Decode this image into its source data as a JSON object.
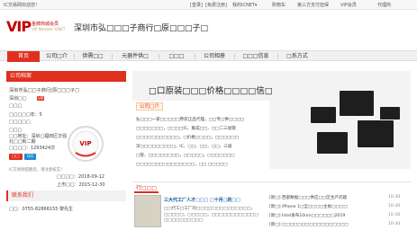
{
  "topbar": {
    "brand": "IC交易网欢迎您！",
    "login": "[登录]",
    "free_reg": "[免费注册]",
    "my": "我的ICNET▾",
    "cart": "购物车",
    "third_party": "第三方支付担保",
    "vip": "VIP会员",
    "proxy": "代理商"
  },
  "logo": {
    "main": "VIP",
    "sub": "金牌商城会员",
    "sub2": "VIP Member ICNET"
  },
  "company_title": "深圳市弘□□□子商行□原□□□子□",
  "nav": {
    "items": [
      "首页",
      "公司□介",
      "供需□□",
      "元器件供□",
      "□□□",
      "公司相册",
      "□□□信息",
      "□系方式"
    ]
  },
  "sidebar": {
    "header": "公司档案",
    "company_name": "深圳市弘□□子商行[原□□□子□",
    "lines": [
      "深圳□□",
      "□□□",
      "□□□□□年：5",
      "□□□□□",
      "□□□"
    ],
    "badge": "VIP",
    "addr": "□□地址：深圳□福田区华强北□□街二期",
    "hits": "□□□□：1293424次",
    "btn_msg": "□□",
    "btn_qq": "QQ",
    "mall_label": "IC交易网提醒您，请注意核实！",
    "reg_date_label": "□□□□：2018-09-12",
    "reg_date2_label": "上市□□：2015-12-30",
    "contact_header": "联系我们",
    "phone": "□□：0755-82866155 黎先生"
  },
  "banner": {
    "text": "□口原装□□□价格□□□□信□"
  },
  "about": {
    "tab": "公司□介",
    "lines": [
      "弘□□□一家□□□□□原装正品代理，□□专□供□□□□",
      "□□□□□□□，□□□□IC、集成□□、□□二三极管",
      "□□□□□□□□□□□，□价格□□□□，□□□□□□",
      "深□□□□□□□□□，IC、□□、□□、□□、三极",
      "□管、□□□□□□□□，□□□□□，□□□□□□□",
      "□□□□□□□□□□□□□□□，□□ □□□□□"
    ]
  },
  "news": {
    "tab": "行□□□",
    "headline": "三大代工厂人才□□□  □十月□的□□",
    "paras": [
      "□□代工□工厂的□□□□□□□□□□□□□□，",
      "□□□□□，□□□□□，□□□□□□□□□□□□",
      "□□□□□□□□□□"
    ],
    "items": [
      "[新□] 西部数据□□□供应□□区生产问题",
      "[新□] iPhone 1□全□□□□主板□□□□",
      "[新□] Intel发布10nm□□□□□□2019",
      "[新□] □□□□□□□□□□□□□□□□□"
    ],
    "dates": [
      "10-30",
      "10-30",
      "10-30",
      "10-30"
    ]
  }
}
